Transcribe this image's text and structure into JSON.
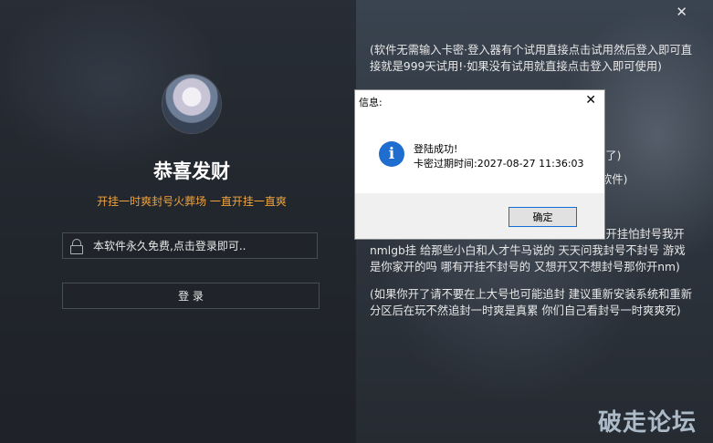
{
  "window": {
    "close_glyph": "✕",
    "title": "恭喜发财",
    "subtitle": "开挂一时爽封号火葬场 一直开挂一直爽",
    "card_input": {
      "placeholder": "本软件永久免费,点击登录即可.."
    },
    "login_label": "登 录",
    "notes": [
      "(软件无需输入卡密·登入器有个试用直接点击试用然后登入即可直接就是999天试用!·如果没有试用就直接点击登入即可使用)",
      "骗了)",
      "软件)",
      "(请尽快申请退款没退款的抓紧时间去退款了)",
      "(开挂一时爽·封号火葬场·如果你害怕封号就不要开挂怕封号我开nmlgb挂 给那些小白和人才牛马说的 天天问我封号不封号 游戏是你家开的吗 哪有开挂不封号的 又想开又不想封号那你开nm)",
      "(如果你开了请不要在上大号也可能追封 建议重新安装系统和重新分区后在玩不然追封一时爽是真累 你们自己看封号一时爽爽死)"
    ],
    "watermark": "破走论坛"
  },
  "dialog": {
    "title": "信息:",
    "close_glyph": "✕",
    "icon": "info-icon",
    "message_line1": "登陆成功!",
    "message_line2": "卡密过期时间:2027-08-27 11:36:03",
    "ok_label": "确定"
  },
  "colors": {
    "accent": "#f2a33a",
    "dialog_icon": "#1f6dcf",
    "ok_border": "#0f6fd6"
  }
}
